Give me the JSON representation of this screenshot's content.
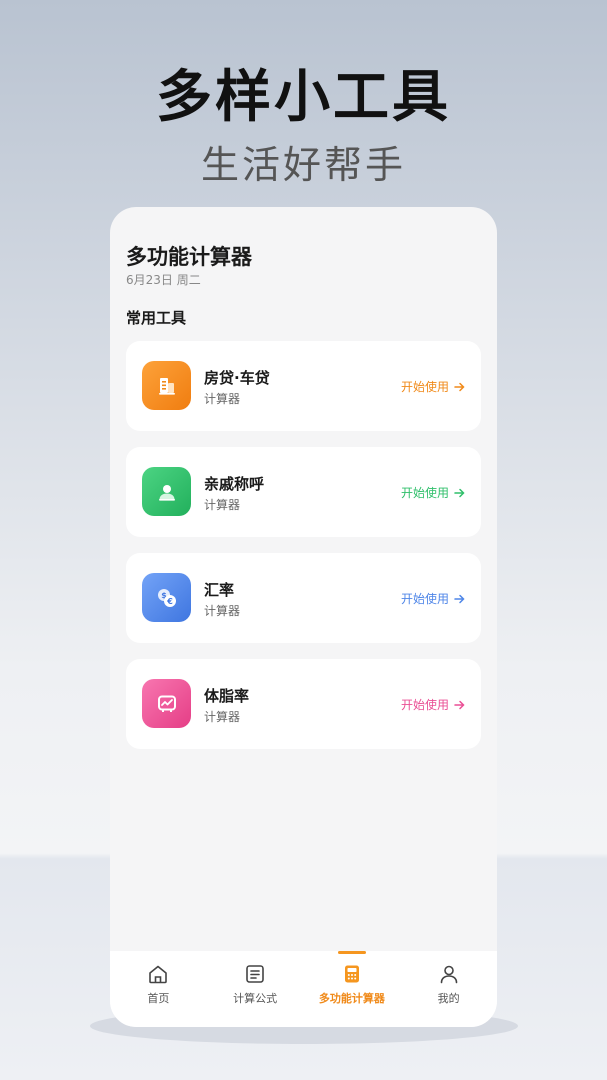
{
  "hero": {
    "title": "多样小工具",
    "subtitle": "生活好帮手"
  },
  "app": {
    "title": "多功能计算器",
    "date": "6月23日 周二",
    "section": "常用工具"
  },
  "tools": [
    {
      "name": "房贷·车贷",
      "sub": "计算器",
      "action": "开始使用",
      "color": "#f08a1a",
      "icon": "building-icon"
    },
    {
      "name": "亲戚称呼",
      "sub": "计算器",
      "action": "开始使用",
      "color": "#2fbf6a",
      "icon": "person-icon"
    },
    {
      "name": "汇率",
      "sub": "计算器",
      "action": "开始使用",
      "color": "#4f86e8",
      "icon": "currency-exchange-icon"
    },
    {
      "name": "体脂率",
      "sub": "计算器",
      "action": "开始使用",
      "color": "#ea4f95",
      "icon": "body-fat-chart-icon"
    }
  ],
  "tabbar": [
    {
      "label": "首页",
      "icon": "home-icon",
      "active": false
    },
    {
      "label": "计算公式",
      "icon": "formula-icon",
      "active": false
    },
    {
      "label": "多功能计算器",
      "icon": "calculator-icon",
      "active": true
    },
    {
      "label": "我的",
      "icon": "user-icon",
      "active": false
    }
  ]
}
